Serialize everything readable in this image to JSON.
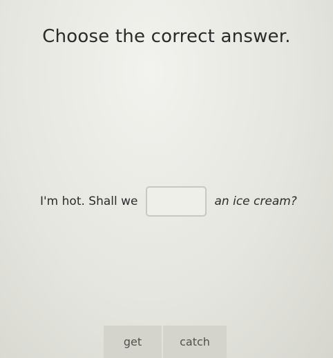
{
  "question": {
    "title": "Choose the correct answer."
  },
  "sentence": {
    "before": "I'm hot. Shall we",
    "after": "an ice cream?",
    "blank_value": ""
  },
  "options": [
    {
      "label": "get"
    },
    {
      "label": "catch"
    }
  ]
}
